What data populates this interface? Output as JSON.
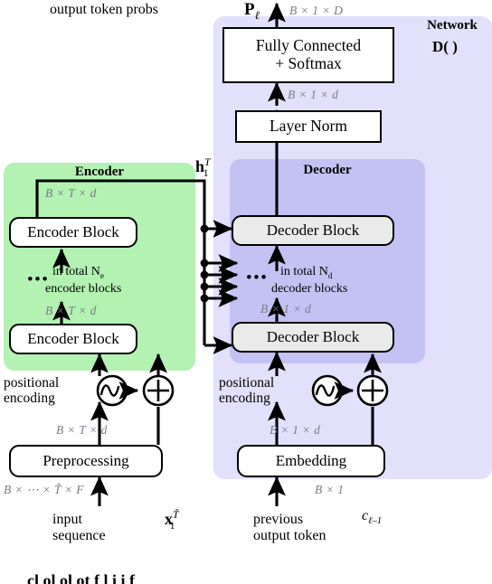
{
  "diagram": {
    "title_network": "Network",
    "network_fn": "D( )",
    "encoder_title": "Encoder",
    "decoder_title": "Decoder"
  },
  "labels": {
    "output_token_probs": "output token probs",
    "p_ell": "P",
    "p_ell_sub": "ℓ",
    "h_symbol": "h",
    "h_sup": "T",
    "h_sub": "1",
    "input_sequence": "input\nsequence",
    "x_symbol": "x",
    "x_sup": "T̃",
    "x_sub": "1",
    "previous_output_token": "previous\noutput token",
    "c_symbol": "c",
    "c_sub": "ℓ–1",
    "positional_encoding_left": "positional\nencoding",
    "positional_encoding_right": "positional\nencoding",
    "in_total_ne": "in total N",
    "in_total_ne_sub": "e",
    "encoder_blocks": "encoder blocks",
    "in_total_nd": "in total N",
    "in_total_nd_sub": "d",
    "decoder_blocks": "decoder blocks",
    "ellipsis": "•••"
  },
  "boxes": {
    "fully_connected": "Fully Connected\n+ Softmax",
    "layer_norm": "Layer Norm",
    "encoder_block_top": "Encoder Block",
    "encoder_block_bottom": "Encoder Block",
    "decoder_block_top": "Decoder Block",
    "decoder_block_bottom": "Decoder Block",
    "preprocessing": "Preprocessing",
    "embedding": "Embedding"
  },
  "tensor_shapes": {
    "probs_out": "B × 1 × D",
    "fc_in": "B × 1 × d",
    "enc_top_out": "B × T × d",
    "enc_bottom_out": "B × T × d",
    "dec_bottom_out": "B × 1 × d",
    "preproc_out": "B × T × d",
    "preproc_in": "B × ⋯ × T̃ × F",
    "embedding_out": "B × 1 × d",
    "embedding_in": "B × 1"
  },
  "icons": {
    "sine_wave": "sine-wave-icon",
    "plus_circle": "plus-circle-icon"
  },
  "colors": {
    "encoder_fill": "#b3f2b3",
    "decoder_fill": "#c4c2f2",
    "network_fill": "#e2e0fb",
    "block_gray": "#eaeaea",
    "dim_text": "#7c7c86",
    "stroke": "#000000"
  },
  "caption_partial": "cl ol ol ot f l i i f"
}
